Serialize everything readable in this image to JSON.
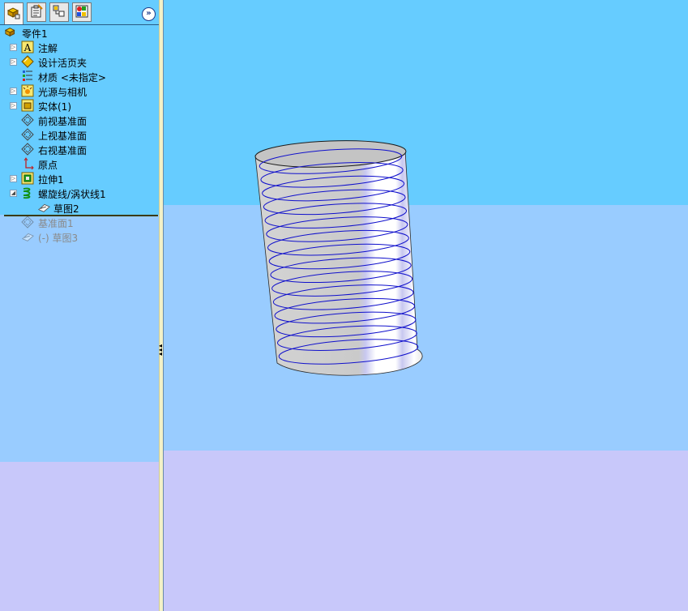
{
  "tree": {
    "items": [
      {
        "label": "零件1",
        "icon": "part-icon"
      },
      {
        "label": "注解",
        "icon": "annotation-icon"
      },
      {
        "label": "设计活页夹",
        "icon": "design-binder-icon"
      },
      {
        "label": "材质 <未指定>",
        "icon": "material-icon"
      },
      {
        "label": "光源与相机",
        "icon": "lights-camera-icon"
      },
      {
        "label": "实体(1)",
        "icon": "solid-bodies-icon"
      },
      {
        "label": "前视基准面",
        "icon": "plane-icon"
      },
      {
        "label": "上视基准面",
        "icon": "plane-icon"
      },
      {
        "label": "右视基准面",
        "icon": "plane-icon"
      },
      {
        "label": "原点",
        "icon": "origin-icon"
      },
      {
        "label": "拉伸1",
        "icon": "extrude-icon"
      },
      {
        "label": "螺旋线/涡状线1",
        "icon": "helix-icon"
      },
      {
        "label": "草图2",
        "icon": "sketch-icon"
      },
      {
        "label": "基准面1",
        "icon": "plane-icon"
      },
      {
        "label": "(-) 草图3",
        "icon": "sketch-icon"
      }
    ]
  },
  "tabs": [
    {
      "name": "feature-manager-tab",
      "icon": "feature-manager-icon"
    },
    {
      "name": "property-manager-tab",
      "icon": "property-manager-icon"
    },
    {
      "name": "configuration-manager-tab",
      "icon": "configuration-manager-icon"
    },
    {
      "name": "display-manager-tab",
      "icon": "display-manager-icon"
    }
  ],
  "colors": {
    "panel_top": "#66ccff",
    "panel_mid": "#99ccff",
    "panel_bottom": "#c8c8fa",
    "helix": "#1010cc",
    "cylinder": "#c8c8c8"
  }
}
